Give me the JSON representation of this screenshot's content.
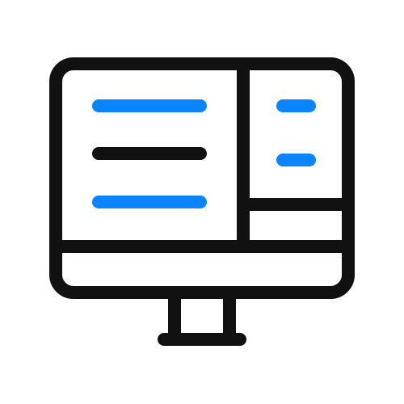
{
  "icon": {
    "name": "desktop-monitor-icon",
    "description": "",
    "colors": {
      "background": "#ffffff",
      "outline": "#111111",
      "accent": "#0a84ff"
    },
    "content_lines": {
      "left_panel": [
        "accent",
        "outline",
        "accent"
      ],
      "right_panel": [
        "accent",
        "accent"
      ]
    }
  }
}
